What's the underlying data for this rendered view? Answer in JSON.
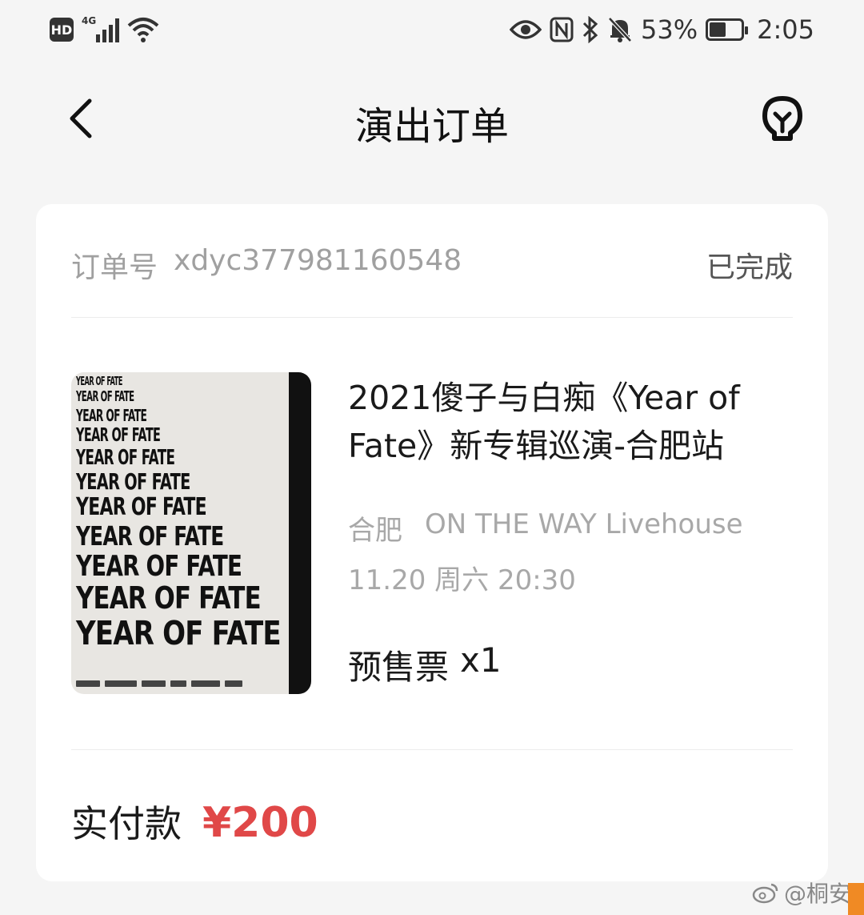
{
  "status_bar": {
    "hd": "HD",
    "network": "4G",
    "battery_percent": "53%",
    "battery_level": 0.53,
    "time": "2:05"
  },
  "nav": {
    "title": "演出订单"
  },
  "order": {
    "number_label": "订单号",
    "number": "xdyc377981160548",
    "status": "已完成"
  },
  "event": {
    "poster_line_text": "YEAR OF FATE",
    "title": "2021傻子与白痴《Year of Fate》新专辑巡演-合肥站",
    "city": "合肥",
    "venue": "ON THE WAY Livehouse",
    "datetime": "11.20 周六 20:30",
    "ticket_type": "预售票",
    "ticket_qty": "x1"
  },
  "payment": {
    "label": "实付款",
    "amount": "¥200"
  },
  "watermark": {
    "text": "@桐安"
  },
  "colors": {
    "accent": "#e04848",
    "background": "#f5f5f5",
    "card": "#ffffff",
    "muted_text": "#a8a8a8"
  }
}
